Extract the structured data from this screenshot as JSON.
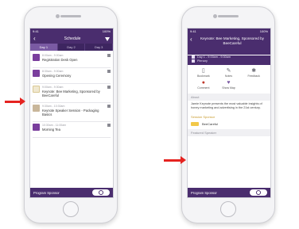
{
  "left_phone": {
    "status": {
      "time": "9:41",
      "battery": "100%"
    },
    "title": "Schedule",
    "tabs": [
      "Day 1",
      "Day 2",
      "Day 3"
    ],
    "items": [
      {
        "time": "8:00am - 9:00am",
        "name": "Registration Desk Open"
      },
      {
        "time": "8:30am - 9:00am",
        "name": "Opening Ceremony"
      },
      {
        "time": "9:00am - 9:30am",
        "name": "Keynote: Bee Marketing, Sponsored by BeeCareful"
      },
      {
        "time": "9:30am - 10:30am",
        "name": "Keynote Speaker Session - Packaging Basics"
      },
      {
        "time": "10:30am - 11:00am",
        "name": "Morning Tea"
      }
    ],
    "footer": "Program Sponsor"
  },
  "right_phone": {
    "status": {
      "time": "9:41",
      "battery": "100%"
    },
    "title": "Keynote: Bee Marketing, Sponsored by BeeCareful",
    "meta": {
      "date": "Day 1 - 9:00am - 9:30am",
      "place": "Plenary"
    },
    "actions": [
      "Bookmark",
      "Notes",
      "Feedback",
      "Comment",
      "Show Map"
    ],
    "about_heading": "About",
    "about_text": "Jamie Keynote presents the most valuable insights of honey marketing and advertising in the 21st century.",
    "sponsor_heading": "Session Sponsor",
    "sponsor_name": "BeeCareful",
    "featured_heading": "Featured Speaker",
    "footer": "Program Sponsor"
  },
  "colors": {
    "primary": "#4a2d6e",
    "arrow": "#e52320",
    "accent": "#c99b2e"
  }
}
